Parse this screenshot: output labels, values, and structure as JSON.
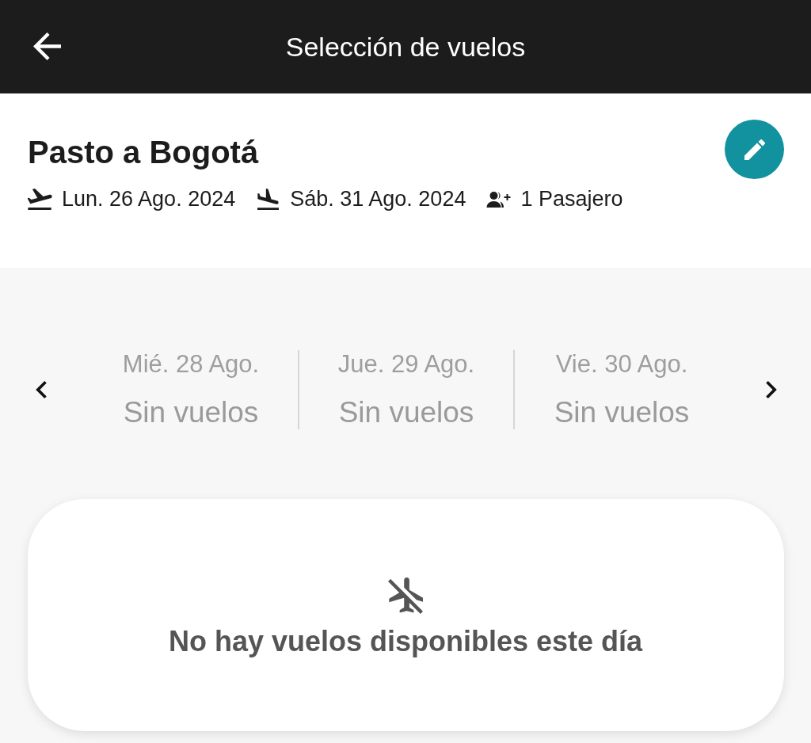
{
  "header": {
    "title": "Selección de vuelos"
  },
  "route": {
    "title": "Pasto a Bogotá",
    "details": [
      {
        "kind": "departure",
        "text": "Lun. 26 Ago. 2024"
      },
      {
        "kind": "return",
        "text": "Sáb. 31 Ago. 2024"
      },
      {
        "kind": "passengers",
        "text": "1 Pasajero"
      }
    ]
  },
  "date_strip": {
    "days": [
      {
        "date": "Mié. 28 Ago.",
        "status": "Sin vuelos"
      },
      {
        "date": "Jue. 29 Ago.",
        "status": "Sin vuelos"
      },
      {
        "date": "Vie. 30 Ago.",
        "status": "Sin vuelos"
      }
    ]
  },
  "empty_state": {
    "message": "No hay vuelos disponibles este día"
  }
}
